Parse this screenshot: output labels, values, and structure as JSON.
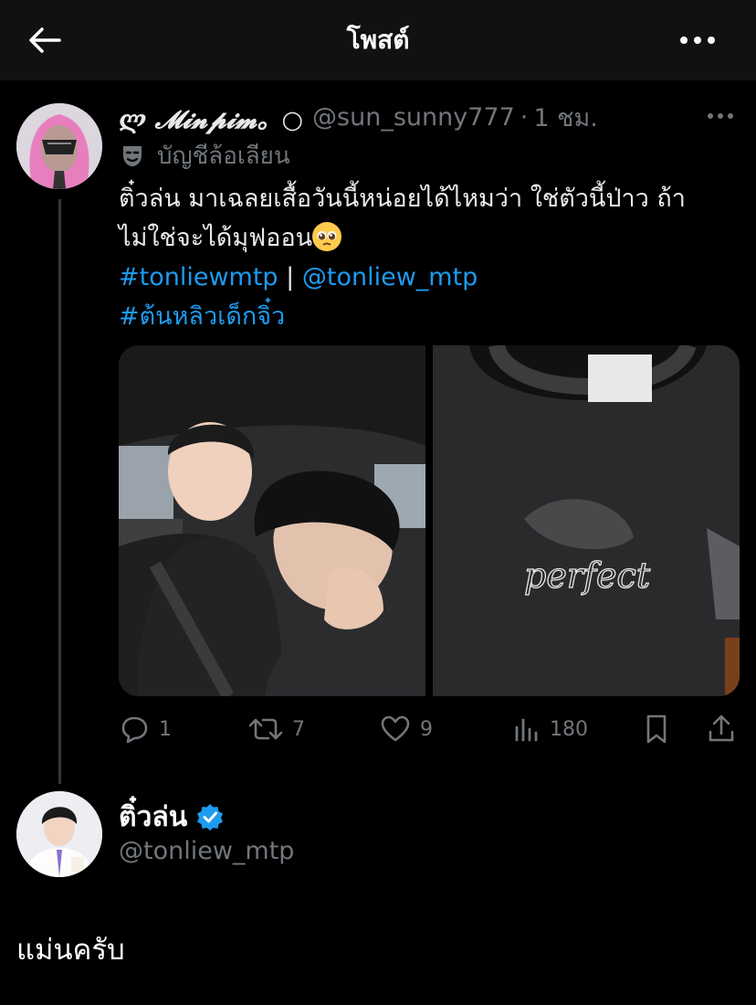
{
  "header": {
    "title": "โพสต์",
    "back_icon": "arrow-left-icon",
    "more_icon": "more-horizontal-icon"
  },
  "quoted_post": {
    "name": "ლ 𝓜𝓲𝓷𝓹𝓲𝓶。○",
    "handle": "@sun_sunny777",
    "separator": "·",
    "time": "1 ชม.",
    "parody_label": "บัญชีล้อเลียน",
    "text_line1": "ติ๋วล่น มาเฉลยเสื้อวันนี้หน่อยได้ไหมว่า ใช่ตัวนี้ป่าว ถ้า",
    "text_line2": "ไม่ใช่จะได้มุฟออน",
    "emoji": "pleading-face",
    "hashtag1": "#tonliewmtp",
    "divider": "|",
    "mention": "@tonliew_mtp",
    "hashtag2": "#ต้นหลิวเด็กจิ๋ว",
    "media": [
      {
        "kind": "photo",
        "subject": "two people in a car"
      },
      {
        "kind": "photo",
        "subject": "black t-shirt with perfect print",
        "print_text": "perfect"
      }
    ],
    "stats": {
      "replies": "1",
      "reposts": "7",
      "likes": "9",
      "views": "180"
    }
  },
  "reply_post": {
    "name": "ติ๋วล่น",
    "verified": true,
    "handle": "@tonliew_mtp",
    "text": "แม่นครับ"
  },
  "colors": {
    "background": "#000000",
    "topbar": "#111112",
    "link": "#1d9bf0",
    "muted": "#71767b",
    "verified": "#1d9bf0"
  }
}
